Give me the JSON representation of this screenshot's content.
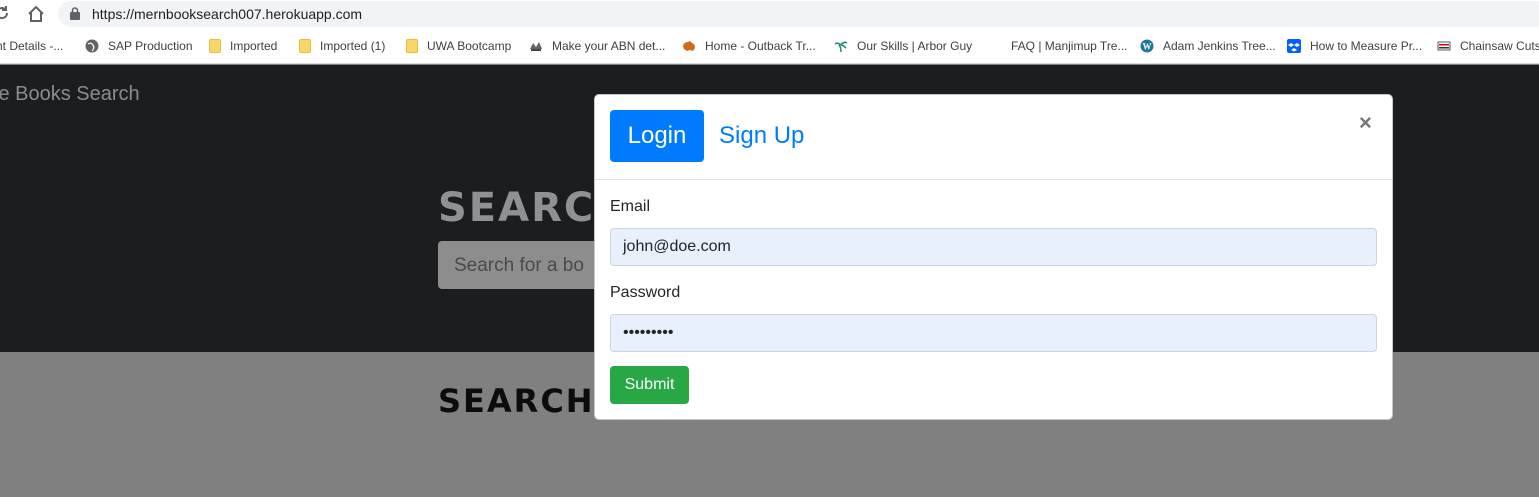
{
  "browser": {
    "url": "https://mernbooksearch007.herokuapp.com"
  },
  "bookmarks": [
    {
      "label": "nt Details -...",
      "icon": "bookmark-icon"
    },
    {
      "label": "SAP Production",
      "icon": "globe-icon"
    },
    {
      "label": "Imported",
      "icon": "folder-icon"
    },
    {
      "label": "Imported (1)",
      "icon": "folder-icon"
    },
    {
      "label": "UWA Bootcamp",
      "icon": "folder-icon"
    },
    {
      "label": "Make your ABN det...",
      "icon": "gov-crest-icon"
    },
    {
      "label": "Home - Outback Tr...",
      "icon": "australia-map-icon"
    },
    {
      "label": "Our Skills | Arbor Guy",
      "icon": "palm-icon"
    },
    {
      "label": "FAQ | Manjimup Tre...",
      "icon": "page-icon"
    },
    {
      "label": "Adam Jenkins Tree...",
      "icon": "wordpress-icon"
    },
    {
      "label": "How to Measure Pr...",
      "icon": "dropbox-icon"
    },
    {
      "label": "Chainsaw Cuts",
      "icon": "chainsaw-expert-icon"
    }
  ],
  "page": {
    "brand": "le Books Search",
    "hero_title": "SEARC",
    "search_placeholder": "Search for a bo",
    "results_title": "SEARCH"
  },
  "modal": {
    "tab_login": "Login",
    "tab_signup": "Sign Up",
    "close": "×",
    "email_label": "Email",
    "email_value": "john@doe.com",
    "password_label": "Password",
    "password_value": "•••••••••",
    "submit_label": "Submit"
  },
  "colors": {
    "primary": "#007bff",
    "success": "#28a745",
    "autofill": "#e8f0fe",
    "hero_bg": "#1b1d1f",
    "overlay": "#808080"
  }
}
